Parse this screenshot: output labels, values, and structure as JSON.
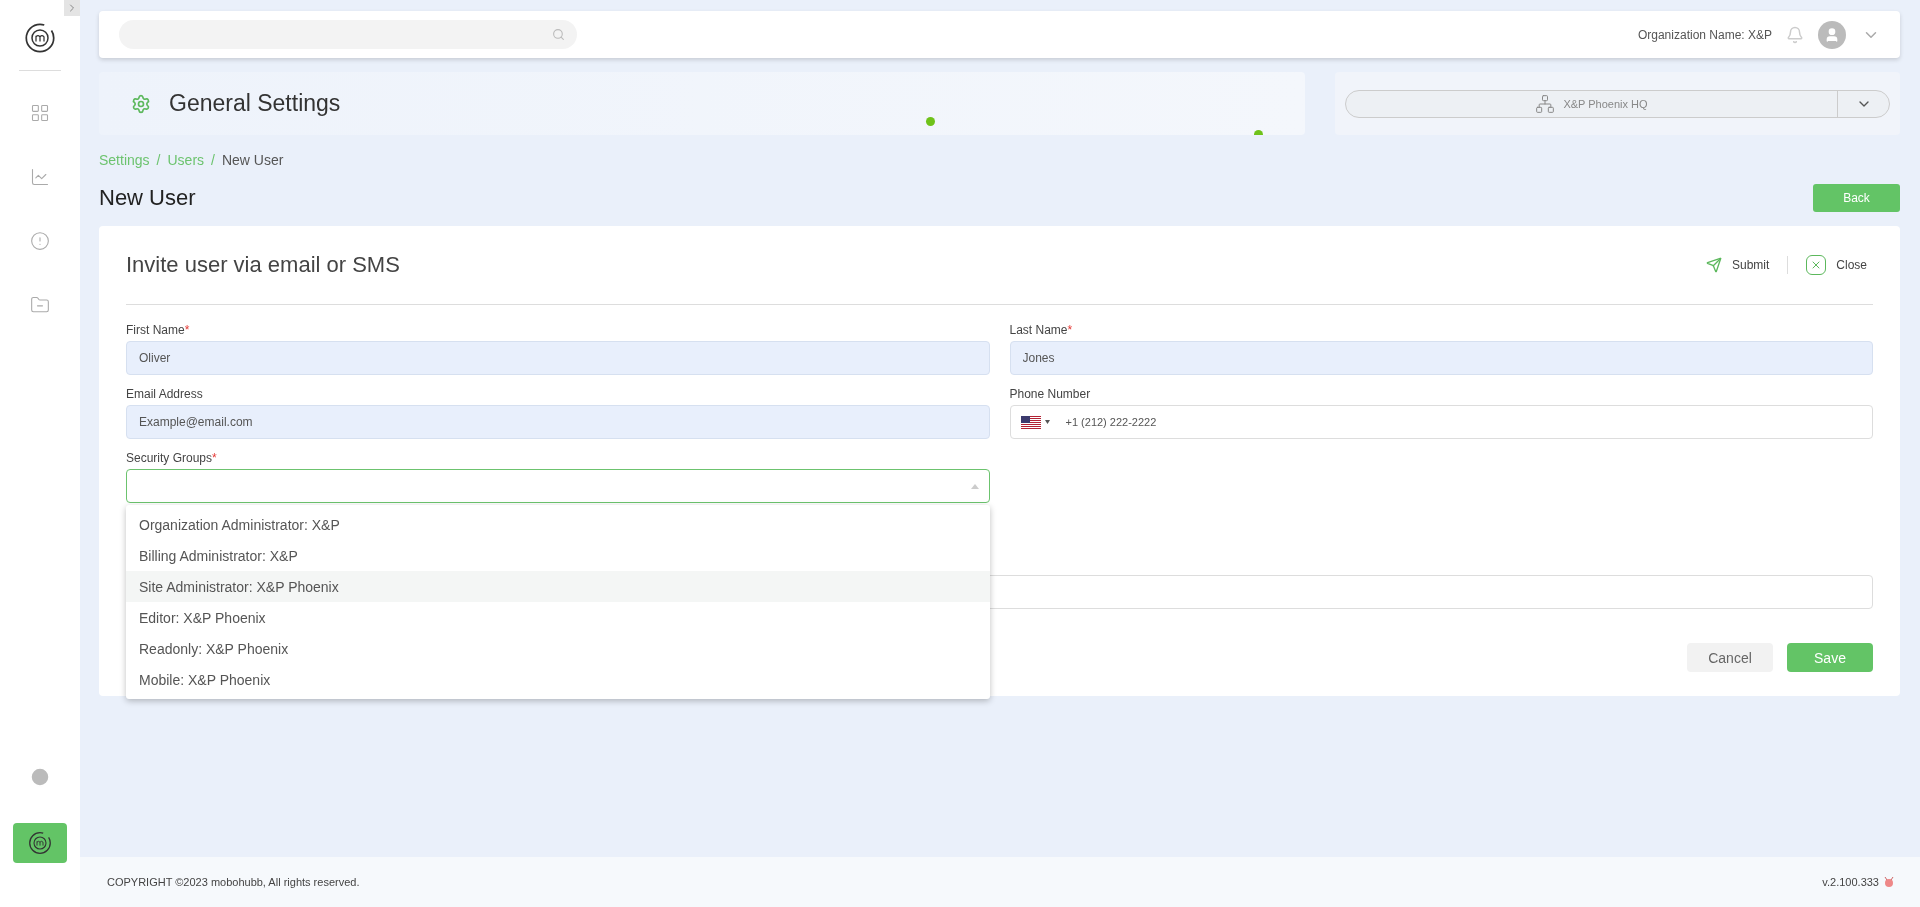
{
  "top_bar": {
    "organization": "Organization Name: X&P"
  },
  "header": {
    "title": "General Settings",
    "site": "X&P Phoenix HQ"
  },
  "breadcrumb": [
    {
      "label": "Settings",
      "current": false
    },
    {
      "separator": "/"
    },
    {
      "label": "Users",
      "current": false
    },
    {
      "separator": "/"
    },
    {
      "label": "New User",
      "current": true
    }
  ],
  "page_title": "New User",
  "back_button": "Back",
  "card": {
    "title": "Invite user via email or SMS",
    "actions": [
      {
        "kind": "submit",
        "label": "Submit"
      },
      {
        "kind": "close",
        "label": "Close"
      }
    ],
    "fields": [
      {
        "label": "First Name",
        "required_mark": "*",
        "value": "Oliver",
        "kind": "text"
      },
      {
        "label": "Last Name",
        "required_mark": "*",
        "value": "Jones",
        "kind": "text"
      },
      {
        "label": "Email Address",
        "value": "Example@email.com",
        "kind": "text"
      },
      {
        "label": "Phone Number",
        "value": "+1 (212) 222-2222",
        "kind": "phone"
      }
    ],
    "security_groups": {
      "label": "Security Groups",
      "required_mark": "*",
      "expanded": true,
      "options": [
        {
          "label": "Organization Administrator: X&P",
          "highlighted": false
        },
        {
          "label": "Billing Administrator: X&P",
          "highlighted": false
        },
        {
          "label": "Site Administrator: X&P Phoenix",
          "highlighted": true
        },
        {
          "label": "Editor: X&P Phoenix",
          "highlighted": false
        },
        {
          "label": "Readonly: X&P Phoenix",
          "highlighted": false
        },
        {
          "label": "Mobile: X&P Phoenix",
          "highlighted": false
        }
      ]
    },
    "buttons": [
      {
        "kind": "cancel",
        "label": "Cancel"
      },
      {
        "kind": "save",
        "label": "Save"
      }
    ]
  },
  "footer": {
    "copyright": "COPYRIGHT ©2023 mobohubb, All rights reserved.",
    "version": "v.2.100.333"
  }
}
